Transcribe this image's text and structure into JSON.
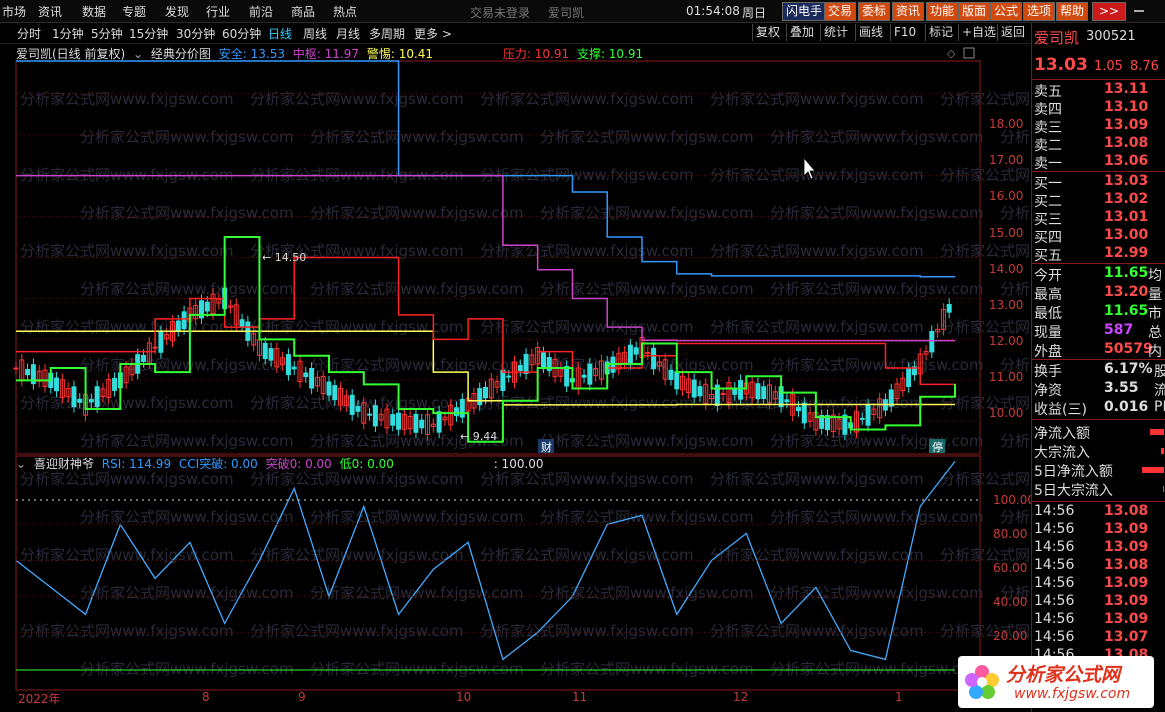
{
  "menu": {
    "items": [
      "市场",
      "资讯",
      "数据",
      "专题",
      "发现",
      "行业",
      "前沿",
      "商品",
      "热点"
    ],
    "login_status": "交易未登录",
    "stock_name": "爱司凯",
    "time": "01:54:08",
    "weekday": "周日",
    "buttons": [
      "闪电手",
      "交易",
      "委标",
      "资讯",
      "功能",
      "版面",
      "公式",
      "选项",
      "帮助"
    ],
    "more": ">>"
  },
  "periods": [
    "分时",
    "1分钟",
    "5分钟",
    "15分钟",
    "30分钟",
    "60分钟",
    "日线",
    "周线",
    "月线",
    "多周期",
    "更多 >"
  ],
  "active_period": "日线",
  "right_tools": [
    "复权",
    "叠加",
    "统计",
    "画线",
    "F10",
    "标记",
    "+自选",
    "返回"
  ],
  "main_legend": {
    "title": "爱司凯(日线 前复权)",
    "indicator": "经典分价图",
    "items": [
      {
        "label": "安全: 13.53",
        "color": "#3399ff"
      },
      {
        "label": "中枢: 11.97",
        "color": "#cc44cc"
      },
      {
        "label": "警惕: 10.41",
        "color": "#ffff55"
      },
      {
        "label": "压力: 10.91",
        "color": "#ff3333"
      },
      {
        "label": "支撑: 10.91",
        "color": "#33ff33"
      }
    ]
  },
  "sub_legend": {
    "title": "喜迎财神爷",
    "items": [
      {
        "label": "RSI: 114.99",
        "color": "#3399ff"
      },
      {
        "label": "CCI突破: 0.00",
        "color": "#3399ff"
      },
      {
        "label": "突破0: 0.00",
        "color": "#cc44cc"
      },
      {
        "label": "低0: 0.00",
        "color": "#33ff33"
      },
      {
        "label": ": 100.00",
        "color": "#dddddd"
      }
    ]
  },
  "price_axis": [
    "18.00",
    "17.00",
    "16.00",
    "15.00",
    "14.00",
    "13.00",
    "12.00",
    "11.00",
    "10.00"
  ],
  "rsi_axis": [
    "100.00",
    "80.00",
    "60.00",
    "40.00",
    "20.00"
  ],
  "dates": [
    "2022年",
    "8",
    "9",
    "10",
    "11",
    "12",
    "1"
  ],
  "annotations": {
    "high": "← 14.50",
    "low": "← 9.44",
    "tag_cai": "财",
    "tag_ting": "停"
  },
  "watermark": "分析家公式网www.fxjgsw.com",
  "quote": {
    "name": "爱司凯",
    "code": "300521",
    "price": "13.03",
    "change": "1.05",
    "pct": "8.76",
    "asks": [
      {
        "k": "卖五",
        "v": "13.11"
      },
      {
        "k": "卖四",
        "v": "13.10"
      },
      {
        "k": "卖三",
        "v": "13.09"
      },
      {
        "k": "卖二",
        "v": "13.08"
      },
      {
        "k": "卖一",
        "v": "13.06"
      }
    ],
    "bids": [
      {
        "k": "买一",
        "v": "13.03"
      },
      {
        "k": "买二",
        "v": "13.02"
      },
      {
        "k": "买三",
        "v": "13.01"
      },
      {
        "k": "买四",
        "v": "13.00"
      },
      {
        "k": "买五",
        "v": "12.99"
      }
    ],
    "stats": [
      {
        "k": "今开",
        "v": "11.65",
        "c": "#33ff33",
        "x": "均"
      },
      {
        "k": "最高",
        "v": "13.20",
        "c": "#ff4a4a",
        "x": "量"
      },
      {
        "k": "最低",
        "v": "11.65",
        "c": "#33ff33",
        "x": "市"
      },
      {
        "k": "现量",
        "v": "587",
        "c": "#cc44ff",
        "x": "总"
      },
      {
        "k": "外盘",
        "v": "50579",
        "c": "#ff4a4a",
        "x": "内"
      }
    ],
    "stats2": [
      {
        "k": "换手",
        "v": "6.17%",
        "x": "股"
      },
      {
        "k": "净资",
        "v": "3.55",
        "x": "流"
      },
      {
        "k": "收益(三)",
        "v": "0.016",
        "x": "PE"
      }
    ],
    "flows": [
      "净流入额",
      "大宗流入",
      "5日净流入额",
      "5日大宗流入"
    ],
    "ticks": [
      {
        "t": "14:56",
        "p": "13.08"
      },
      {
        "t": "14:56",
        "p": "13.09"
      },
      {
        "t": "14:56",
        "p": "13.09"
      },
      {
        "t": "14:56",
        "p": "13.08"
      },
      {
        "t": "14:56",
        "p": "13.09"
      },
      {
        "t": "14:56",
        "p": "13.09"
      },
      {
        "t": "14:56",
        "p": "13.09"
      },
      {
        "t": "14:56",
        "p": "13.07"
      },
      {
        "t": "14:56",
        "p": "13.08"
      }
    ]
  },
  "logo": {
    "text": "分析家公式网",
    "url": "www.fxjgsw.com"
  },
  "colors": {
    "up": "#ff3333",
    "down": "#33ffff",
    "safe": "#3399ff",
    "center": "#cc44cc",
    "warn": "#ffff55",
    "press": "#ff2222",
    "support": "#33ff33",
    "rsi": "#44aaff",
    "grid": "#8a1a1a"
  },
  "chart_data": [
    {
      "type": "line",
      "name_hint": "price panel",
      "ylim": [
        9.2,
        18.8
      ],
      "x_ticks": [
        "2022年",
        "8",
        "9",
        "10",
        "11",
        "12",
        "1"
      ],
      "series": [
        {
          "name": "安全",
          "values": [
            18.8,
            18.8,
            18.8,
            18.8,
            18.8,
            18.8,
            18.8,
            18.8,
            18.8,
            18.8,
            18.8,
            16.0,
            16.0,
            16.0,
            16.0,
            16.0,
            15.6,
            14.5,
            13.9,
            13.6,
            13.55,
            13.55,
            13.55,
            13.55,
            13.55,
            13.55,
            13.53,
            13.53
          ]
        },
        {
          "name": "中枢",
          "values": [
            16.0,
            16.0,
            16.0,
            16.0,
            16.0,
            16.0,
            16.0,
            16.0,
            16.0,
            16.0,
            16.0,
            16.0,
            16.0,
            16.0,
            14.3,
            13.7,
            13.0,
            12.3,
            11.98,
            11.97,
            11.97,
            11.97,
            11.97,
            11.97,
            11.97,
            11.97,
            11.97,
            11.97
          ]
        },
        {
          "name": "警惕",
          "values": [
            12.2,
            12.2,
            12.2,
            12.2,
            12.2,
            12.2,
            12.2,
            12.2,
            12.2,
            12.2,
            12.2,
            12.2,
            11.2,
            10.5,
            10.4,
            10.4,
            10.4,
            10.4,
            10.4,
            10.41,
            10.41,
            10.41,
            10.41,
            10.41,
            10.41,
            10.41,
            10.41,
            10.41
          ]
        },
        {
          "name": "压力",
          "values": [
            11.7,
            11.7,
            11.7,
            11.7,
            12.5,
            13.0,
            12.3,
            12.5,
            14.0,
            14.0,
            14.0,
            12.6,
            12.0,
            12.5,
            11.2,
            11.7,
            10.8,
            11.3,
            11.6,
            11.9,
            11.9,
            11.9,
            11.9,
            11.9,
            11.9,
            11.3,
            10.9,
            10.91
          ]
        },
        {
          "name": "支撑",
          "values": [
            11.0,
            11.3,
            10.3,
            11.4,
            11.2,
            12.6,
            14.5,
            12.0,
            11.6,
            11.2,
            10.9,
            10.3,
            10.2,
            9.5,
            10.5,
            11.3,
            10.8,
            11.4,
            11.9,
            11.2,
            10.8,
            11.1,
            10.7,
            10.1,
            9.8,
            9.9,
            10.6,
            10.91
          ]
        },
        {
          "name": "收盘",
          "values": [
            11.3,
            11.0,
            10.4,
            11.0,
            11.8,
            12.6,
            13.0,
            11.8,
            11.3,
            10.8,
            10.2,
            10.0,
            9.9,
            10.4,
            11.0,
            11.6,
            11.0,
            11.3,
            11.8,
            11.0,
            10.6,
            10.8,
            10.6,
            10.0,
            9.9,
            10.4,
            11.4,
            13.03
          ]
        }
      ]
    },
    {
      "type": "line",
      "name_hint": "RSI panel",
      "ylim": [
        -12,
        118
      ],
      "series": [
        {
          "name": "RSI",
          "values": [
            60,
            45,
            30,
            80,
            50,
            70,
            25,
            60,
            100,
            40,
            90,
            30,
            55,
            70,
            5,
            20,
            40,
            80,
            85,
            30,
            60,
            75,
            25,
            45,
            10,
            5,
            90,
            115
          ]
        },
        {
          "name": "低0",
          "values": [
            0,
            0,
            0,
            0,
            0,
            0,
            0,
            0,
            0,
            0,
            0,
            0,
            0,
            0,
            0,
            0,
            0,
            0,
            0,
            0,
            0,
            0,
            0,
            0,
            0,
            0,
            0,
            0
          ]
        }
      ]
    }
  ]
}
